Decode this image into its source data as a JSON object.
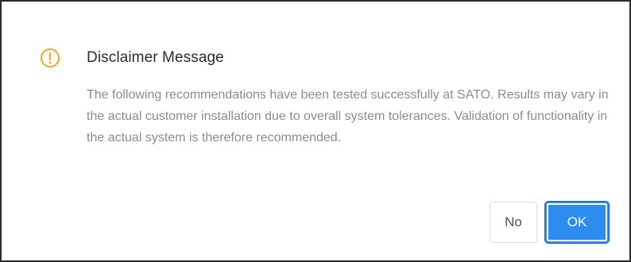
{
  "dialog": {
    "title": "Disclaimer Message",
    "icon": "warning-circle-icon",
    "message": "The following recommendations have been tested successfully at SATO. Results may vary in the actual customer installation due to overall system tolerances. Validation of functionality in the actual system is therefore recommended.",
    "buttons": {
      "no_label": "No",
      "ok_label": "OK"
    }
  },
  "colors": {
    "warning": "#f5a623",
    "primary": "#2d8cf0",
    "border": "#2b2b2b",
    "text_muted": "#8c8c8c"
  }
}
